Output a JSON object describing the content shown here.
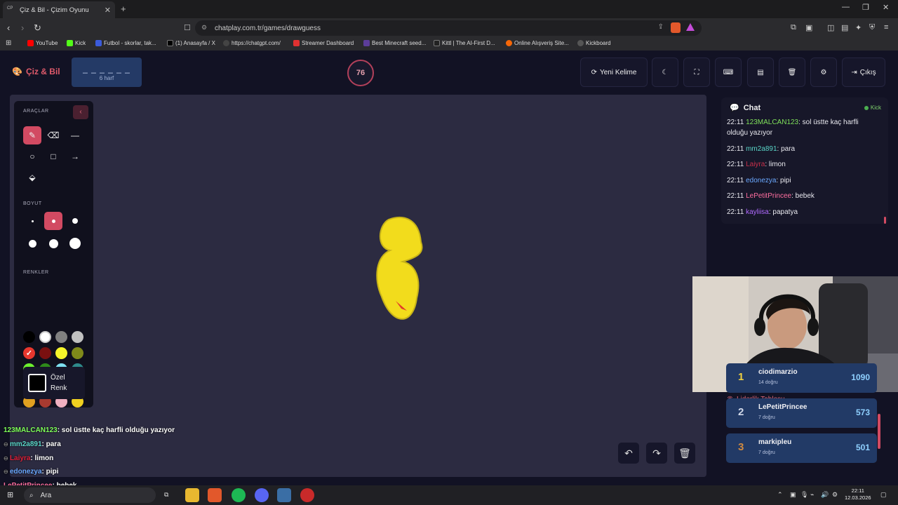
{
  "browser": {
    "tab_title": "Çiz & Bil - Çizim Oyunu",
    "tab_favicon": "CP",
    "url": "chatplay.com.tr/games/drawguess",
    "bookmarks": [
      {
        "label": "YouTube",
        "color": "#ff0000"
      },
      {
        "label": "Kick",
        "color": "#53fc18"
      },
      {
        "label": "Futbol - skorlar, tak...",
        "color": "#3b5bdb"
      },
      {
        "label": "(1) Anasayfa / X",
        "color": "#000000"
      },
      {
        "label": "https://chatgpt.com/",
        "color": "#444444"
      },
      {
        "label": "Streamer Dashboard",
        "color": "#e03131"
      },
      {
        "label": "Best Minecraft seed...",
        "color": "#5c3d99"
      },
      {
        "label": "Kittl | The AI-First D...",
        "color": "#222222"
      },
      {
        "label": "Online Alışveriş Site...",
        "color": "#f76707"
      },
      {
        "label": "Kickboard",
        "color": "#555555"
      }
    ]
  },
  "app": {
    "brand": "Çiz & Bil",
    "word_dashes": "_ _ _ _ _ _",
    "word_length_label": "6 harf",
    "timer": "76",
    "new_word_label": "Yeni Kelime",
    "exit_label": "Çıkış"
  },
  "tools": {
    "tools_label": "ARAÇLAR",
    "size_label": "BOYUT",
    "colors_label": "RENKLER",
    "custom_color_line1": "Özel",
    "custom_color_line2": "Renk",
    "palette": [
      "#000000",
      "#ffffff",
      "#808080",
      "#c0c0c0",
      "#e8372e",
      "#7a1010",
      "#f5f52a",
      "#808a1a",
      "#6cf02e",
      "#2e8a1a",
      "#7de0f0",
      "#2e8a8a",
      "#1a1af0",
      "#101070",
      "#e02ee0",
      "#8a1a8a",
      "#e0a020",
      "#a83a30",
      "#f0b0c0",
      "#f0d020"
    ]
  },
  "overlay_chat": [
    {
      "user": "123MALCAN123",
      "color": "#7fff5a",
      "message": ": sol üstte kaç harfli olduğu yazıyor"
    },
    {
      "user": "mm2a891",
      "color": "#5ad6c8",
      "message": ": para"
    },
    {
      "user": "Laiyra",
      "color": "#e0203a",
      "message": ": limon"
    },
    {
      "user": "edonezya",
      "color": "#6aa8ff",
      "message": ": pipi"
    },
    {
      "user": "LePetitPrincee",
      "color": "#ff6fa0",
      "message": ": bebek"
    }
  ],
  "chat": {
    "title": "Chat",
    "platform": "Kick",
    "messages": [
      {
        "time": "22:11",
        "user": "123MALCAN123",
        "color": "#7fe05a",
        "text": ": sol üstte kaç harfli olduğu yazıyor"
      },
      {
        "time": "22:11",
        "user": "mm2a891",
        "color": "#5ad6c8",
        "text": ": para"
      },
      {
        "time": "22:11",
        "user": "Laiyra",
        "color": "#c8304a",
        "text": ": limon"
      },
      {
        "time": "22:11",
        "user": "edonezya",
        "color": "#6aa8ff",
        "text": ": pipi"
      },
      {
        "time": "22:11",
        "user": "LePetitPrincee",
        "color": "#ff6fa0",
        "text": ": bebek"
      },
      {
        "time": "22:11",
        "user": "kayliisa",
        "color": "#b06aff",
        "text": ": papatya"
      }
    ]
  },
  "leaderboard": {
    "title": "Liderlik Tablosu",
    "entries": [
      {
        "rank": "1",
        "name": "ciodimarzio",
        "sub": "14 doğru",
        "score": "1090",
        "rank_color": "#f0d040"
      },
      {
        "rank": "2",
        "name": "LePetitPrincee",
        "sub": "7 doğru",
        "score": "573",
        "rank_color": "#d0d8e8"
      },
      {
        "rank": "3",
        "name": "markipleu",
        "sub": "7 doğru",
        "score": "501",
        "rank_color": "#d08a40"
      }
    ]
  },
  "taskbar": {
    "search_placeholder": "Ara",
    "time": "22:11",
    "date": "12.03.2026"
  }
}
